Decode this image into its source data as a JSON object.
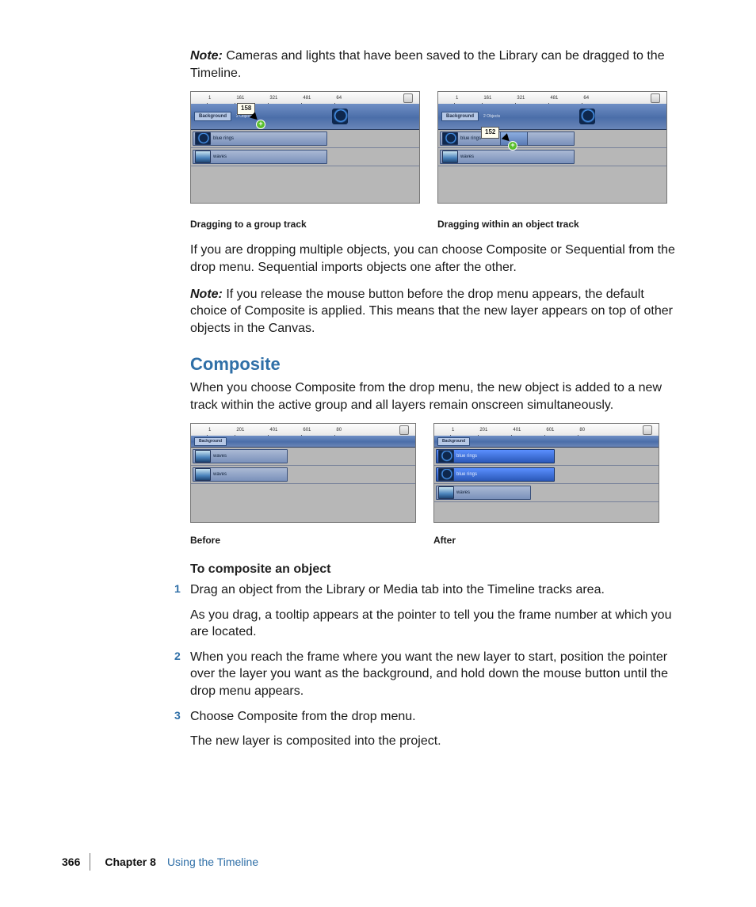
{
  "note1": {
    "label": "Note:",
    "text": "Cameras and lights that have been saved to the Library can be dragged to the Timeline."
  },
  "figrow1": {
    "left": {
      "ruler": [
        "1",
        "161",
        "321",
        "481",
        "64"
      ],
      "group": {
        "label": "Background",
        "sub": "2 Objects"
      },
      "tooltip": "158",
      "clip1": "blue rings",
      "clip2": "waves",
      "caption": "Dragging to a group track"
    },
    "right": {
      "ruler": [
        "1",
        "161",
        "321",
        "481",
        "64"
      ],
      "group": {
        "label": "Background",
        "sub": "2 Objects"
      },
      "tooltip": "152",
      "clip1": "blue rings",
      "clip2": "waves",
      "caption": "Dragging within an object track"
    }
  },
  "para_multi": "If you are dropping multiple objects, you can choose Composite or Sequential from the drop menu. Sequential imports objects one after the other.",
  "note2": {
    "label": "Note:",
    "text": "If you release the mouse button before the drop menu appears, the default choice of Composite is applied. This means that the new layer appears on top of other objects in the Canvas."
  },
  "heading": "Composite",
  "heading_para": "When you choose Composite from the drop menu, the new object is added to a new track within the active group and all layers remain onscreen simultaneously.",
  "figrow2": {
    "left": {
      "ruler": [
        "1",
        "201",
        "401",
        "601",
        "80"
      ],
      "group": {
        "label": "Background"
      },
      "clip1": "waves",
      "clip2": "waves",
      "caption": "Before"
    },
    "right": {
      "ruler": [
        "1",
        "201",
        "401",
        "601",
        "80"
      ],
      "group": {
        "label": "Background"
      },
      "clip1": "blue rings",
      "clip2": "blue rings",
      "clip3": "waves",
      "caption": "After"
    }
  },
  "subhead": "To composite an object",
  "steps": {
    "s1a": "Drag an object from the Library or Media tab into the Timeline tracks area.",
    "s1b": "As you drag, a tooltip appears at the pointer to tell you the frame number at which you are located.",
    "s2": "When you reach the frame where you want the new layer to start, position the pointer over the layer you want as the background, and hold down the mouse button until the drop menu appears.",
    "s3a": "Choose Composite from the drop menu.",
    "s3b": "The new layer is composited into the project."
  },
  "nums": {
    "n1": "1",
    "n2": "2",
    "n3": "3"
  },
  "footer": {
    "page": "366",
    "chapter": "Chapter 8",
    "title": "Using the Timeline"
  }
}
